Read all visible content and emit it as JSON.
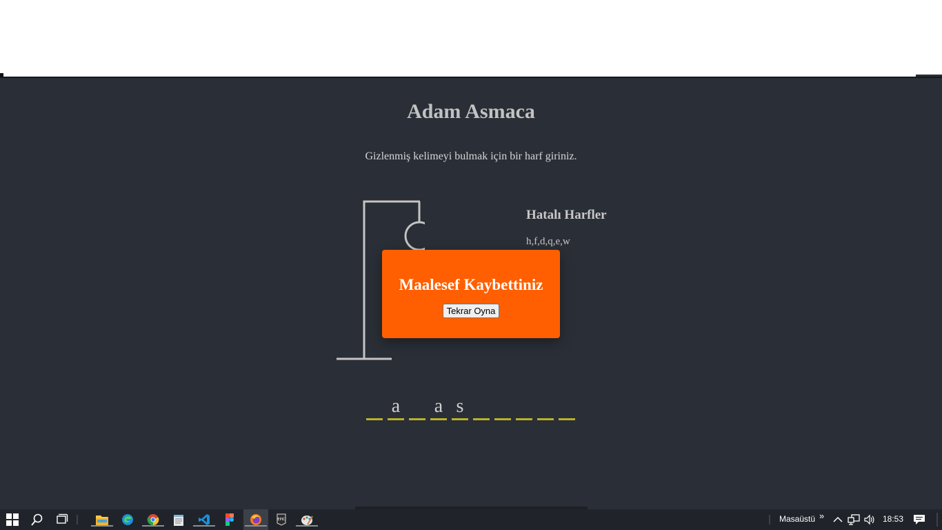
{
  "game": {
    "title": "Adam Asmaca",
    "subtitle": "Gizlenmiş kelimeyi bulmak için bir harf giriniz.",
    "wrong_letters_title": "Hatalı Harfler",
    "wrong_letters": "h,f,d,q,e,w",
    "word_slots": [
      "",
      "a",
      "",
      "a",
      "s",
      "",
      "",
      "",
      "",
      ""
    ],
    "colors": {
      "background": "#2a2e36",
      "popup": "#ff5f00",
      "underline": "#b8b32a"
    }
  },
  "popup": {
    "message": "Maalesef Kaybettiniz",
    "button_label": "Tekrar Oyna"
  },
  "taskbar": {
    "apps": [
      "file-explorer-icon",
      "edge-icon",
      "chrome-icon",
      "notepad-icon",
      "vscode-icon",
      "figma-icon",
      "firefox-icon",
      "epic-games-icon",
      "paint-icon"
    ],
    "desktop_label": "Masaüstü",
    "chevron": "»",
    "time": "18:53"
  }
}
